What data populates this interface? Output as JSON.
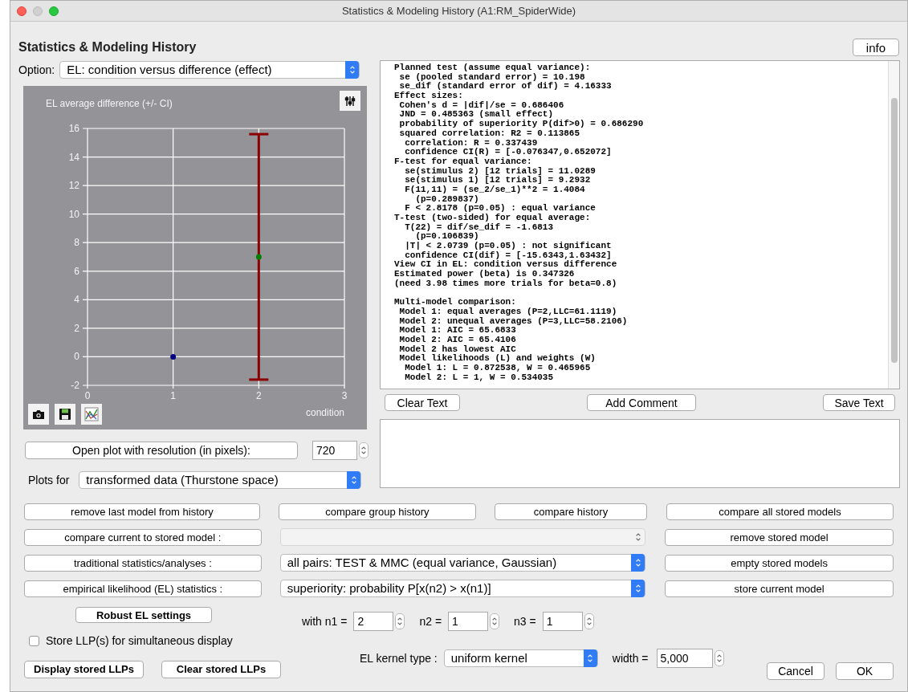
{
  "window": {
    "title": "Statistics & Modeling History (A1:RM_SpiderWide)"
  },
  "header": {
    "title": "Statistics & Modeling History",
    "info_button": "info"
  },
  "option": {
    "label": "Option:",
    "value": "EL: condition versus difference (effect)"
  },
  "plot": {
    "chart_data": {
      "type": "scatter",
      "title": "EL average difference (+/- CI)",
      "xlabel": "condition",
      "x": [
        1,
        2
      ],
      "xlim": [
        0,
        3
      ],
      "ylim": [
        -2,
        16
      ],
      "xticks": [
        0,
        1,
        2,
        3
      ],
      "yticks": [
        -2,
        0,
        2,
        4,
        6,
        8,
        10,
        12,
        14,
        16
      ],
      "grid": true,
      "series": [
        {
          "color": "#000080",
          "values": [
            0,
            null
          ]
        },
        {
          "color": "#008000",
          "values": [
            null,
            7
          ],
          "errors": [
            null,
            [
              -1.6,
              15.6
            ]
          ]
        }
      ]
    }
  },
  "resolution": {
    "button": "Open plot with resolution (in pixels):",
    "value": "720"
  },
  "plots_for": {
    "label": "Plots for",
    "value": "transformed data (Thurstone space)"
  },
  "output": {
    "sections": [
      {
        "lines": [
          "Planned test (assume equal variance):",
          " se (pooled standard error) = 10.198",
          " se_dif (standard error of dif) = 4.16333",
          "Effect sizes:",
          " Cohen's d = |dif|/se = 0.686406",
          " JND = 0.485363 (small effect)",
          " probability of superiority P(dif>0) = 0.686290",
          " squared correlation: R2 = 0.113865",
          "  correlation: R = 0.337439",
          "  confidence CI(R) = [-0.076347,0.652072]",
          "F-test for equal variance:",
          "  se(stimulus 2) [12 trials] = 11.0289",
          "  se(stimulus 1) [12 trials] = 9.2932",
          "  F(11,11) = (se_2/se_1)**2 = 1.4084",
          "    (p=0.289837)",
          "  F < 2.8178 (p=0.05) : equal variance",
          "T-test (two-sided) for equal average:",
          "  T(22) = dif/se_dif = -1.6813",
          "    (p=0.106839)",
          "  |T| < 2.0739 (p=0.05) : not significant",
          "  confidence CI(dif) = [-15.6343,1.63432]",
          "View CI in EL: condition versus difference",
          "Estimated power (beta) is 0.347326",
          "(need 3.98 times more trials for beta=0.8)"
        ]
      },
      {
        "lines": [
          "Multi-model comparison:",
          " Model 1: equal averages (P=2,LLC=61.1119)",
          " Model 2: unequal averages (P=3,LLC=58.2106)",
          " Model 1: AIC = 65.6833",
          " Model 2: AIC = 65.4106",
          " Model 2 has lowest AIC",
          " Model likelihoods (L) and weights (W)",
          "  Model 1: L = 0.872538, W = 0.465965",
          "  Model 2: L = 1, W = 0.534035"
        ]
      }
    ]
  },
  "text_buttons": [
    "Clear Text",
    "Add Comment",
    "Save Text"
  ],
  "actions": [
    {
      "left": "remove last model from history",
      "middle": [
        {
          "kind": "button",
          "label": "compare group history"
        },
        {
          "kind": "button",
          "label": "compare history"
        }
      ],
      "right": "compare all stored models"
    },
    {
      "left": "compare current to stored model :",
      "middle": [
        {
          "kind": "select",
          "disabled": true
        }
      ],
      "right": "remove stored model"
    },
    {
      "left": "traditional statistics/analyses :",
      "middle": [
        {
          "kind": "select",
          "disabled": false,
          "value": "all pairs: TEST & MMC (equal variance, Gaussian)"
        }
      ],
      "right": "empty stored models"
    },
    {
      "left": "empirical likelihood (EL) statistics :",
      "middle": [
        {
          "kind": "select",
          "disabled": false,
          "value": "superiority: probability P[x(n2) > x(n1)]"
        }
      ],
      "right": "store current model"
    }
  ],
  "robust_button": "Robust EL settings",
  "indices": [
    {
      "label": "with n1 =",
      "value": "2"
    },
    {
      "label": "n2 =",
      "value": "1"
    },
    {
      "label": "n3 =",
      "value": "1"
    }
  ],
  "store_llp": {
    "label": "Store LLP(s) for simultaneous display",
    "checked": false
  },
  "llp_buttons": [
    "Display stored LLPs",
    "Clear stored LLPs"
  ],
  "kernel": {
    "label": "EL kernel type :",
    "value": "uniform kernel",
    "width_label": "width =",
    "width_value": "5,000"
  },
  "dialog_buttons": [
    "Cancel",
    "OK"
  ]
}
